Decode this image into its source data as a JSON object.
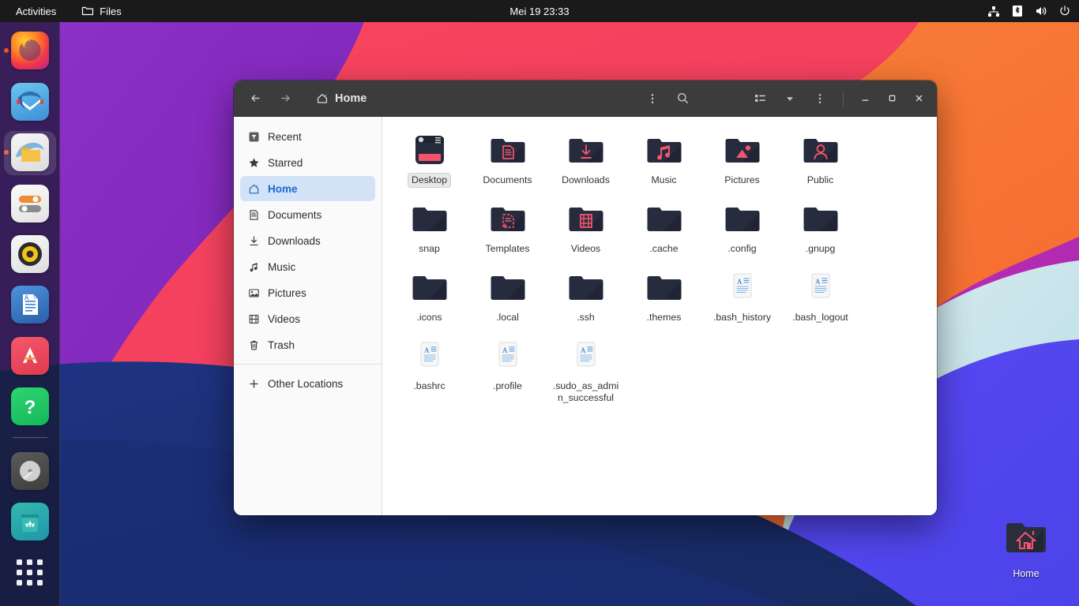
{
  "topbar": {
    "activities_label": "Activities",
    "app_label": "Files",
    "app_icon": "folder-icon",
    "clock": "Mei 19  23:33",
    "status_icons": [
      {
        "name": "network-icon",
        "label": "Network"
      },
      {
        "name": "bluetooth-icon",
        "label": "Bluetooth"
      },
      {
        "name": "volume-icon",
        "label": "Volume"
      },
      {
        "name": "power-icon",
        "label": "Power"
      }
    ]
  },
  "dock": {
    "items": [
      {
        "name": "firefox",
        "label": "Firefox Web Browser",
        "running": true
      },
      {
        "name": "thunderbird",
        "label": "Thunderbird Mail",
        "running": false
      },
      {
        "name": "files",
        "label": "Files",
        "running": true,
        "active": true
      },
      {
        "name": "settings",
        "label": "Settings",
        "running": false
      },
      {
        "name": "rhythmbox",
        "label": "Rhythmbox",
        "running": false
      },
      {
        "name": "libreoffice-writer",
        "label": "LibreOffice Writer",
        "running": false
      },
      {
        "name": "ubuntu-software",
        "label": "Ubuntu Software",
        "running": false
      },
      {
        "name": "help",
        "label": "Help",
        "running": false
      },
      {
        "name": "disks",
        "label": "Disks",
        "running": false
      },
      {
        "name": "trash",
        "label": "Trash",
        "running": false
      }
    ],
    "show_apps_label": "Show Applications"
  },
  "desktop": {
    "icons": [
      {
        "name": "home",
        "label": "Home",
        "icon": "folder-home-icon"
      }
    ]
  },
  "window": {
    "title": "Home",
    "path_label": "Home",
    "header_buttons": {
      "back": "Back",
      "forward": "Forward",
      "path_menu": "Path options",
      "search": "Search",
      "view_list": "View options",
      "view_dropdown": "View type",
      "main_menu": "Main menu",
      "minimize": "Minimize",
      "maximize": "Maximize",
      "close": "Close"
    }
  },
  "sidebar": {
    "items": [
      {
        "label": "Recent",
        "icon": "recent-icon",
        "selected": false
      },
      {
        "label": "Starred",
        "icon": "star-icon",
        "selected": false
      },
      {
        "label": "Home",
        "icon": "home-icon",
        "selected": true
      },
      {
        "label": "Documents",
        "icon": "document-icon",
        "selected": false
      },
      {
        "label": "Downloads",
        "icon": "download-icon",
        "selected": false
      },
      {
        "label": "Music",
        "icon": "music-icon",
        "selected": false
      },
      {
        "label": "Pictures",
        "icon": "picture-icon",
        "selected": false
      },
      {
        "label": "Videos",
        "icon": "video-icon",
        "selected": false
      },
      {
        "label": "Trash",
        "icon": "trash-icon",
        "selected": false
      }
    ],
    "other_locations": {
      "label": "Other Locations",
      "icon": "plus-icon"
    }
  },
  "files": [
    {
      "label": "Desktop",
      "type": "folder-desktop",
      "selected": true
    },
    {
      "label": "Documents",
      "type": "folder-documents",
      "selected": false
    },
    {
      "label": "Downloads",
      "type": "folder-downloads",
      "selected": false
    },
    {
      "label": "Music",
      "type": "folder-music",
      "selected": false
    },
    {
      "label": "Pictures",
      "type": "folder-pictures",
      "selected": false
    },
    {
      "label": "Public",
      "type": "folder-public",
      "selected": false
    },
    {
      "label": "snap",
      "type": "folder-plain",
      "selected": false
    },
    {
      "label": "Templates",
      "type": "folder-templates",
      "selected": false
    },
    {
      "label": "Videos",
      "type": "folder-videos",
      "selected": false
    },
    {
      "label": ".cache",
      "type": "folder-plain",
      "selected": false
    },
    {
      "label": ".config",
      "type": "folder-plain",
      "selected": false
    },
    {
      "label": ".gnupg",
      "type": "folder-plain",
      "selected": false
    },
    {
      "label": ".icons",
      "type": "folder-plain",
      "selected": false
    },
    {
      "label": ".local",
      "type": "folder-plain",
      "selected": false
    },
    {
      "label": ".ssh",
      "type": "folder-plain",
      "selected": false
    },
    {
      "label": ".themes",
      "type": "folder-plain",
      "selected": false
    },
    {
      "label": ".bash_history",
      "type": "text-file",
      "selected": false
    },
    {
      "label": ".bash_logout",
      "type": "text-file",
      "selected": false
    },
    {
      "label": ".bashrc",
      "type": "text-file",
      "selected": false
    },
    {
      "label": ".profile",
      "type": "text-file",
      "selected": false
    },
    {
      "label": ".sudo_as_admin_successful",
      "type": "text-file",
      "selected": false
    }
  ],
  "colors": {
    "accent": "#e95420",
    "folder_dark": "#262b3d",
    "folder_symbol": "#f4546a",
    "sidebar_selected_bg": "#d3e3f7",
    "sidebar_selected_fg": "#1b6acb",
    "headerbar_bg": "#3c3c3c",
    "topbar_bg": "#1a1a1a"
  }
}
